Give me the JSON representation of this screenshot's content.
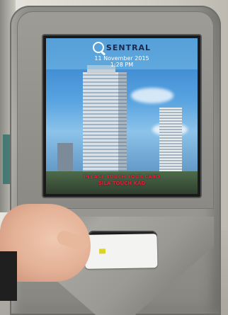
{
  "screen": {
    "brand": "SENTRAL",
    "date": "11  November  2015",
    "time": "1:28 PM",
    "message_line1": "PLEASE  TOUCH  YOUR  CARD",
    "message_line2": "SILA TOUCH KAD"
  },
  "colors": {
    "message": "#e0203a",
    "kiosk": "#9d9c96"
  }
}
